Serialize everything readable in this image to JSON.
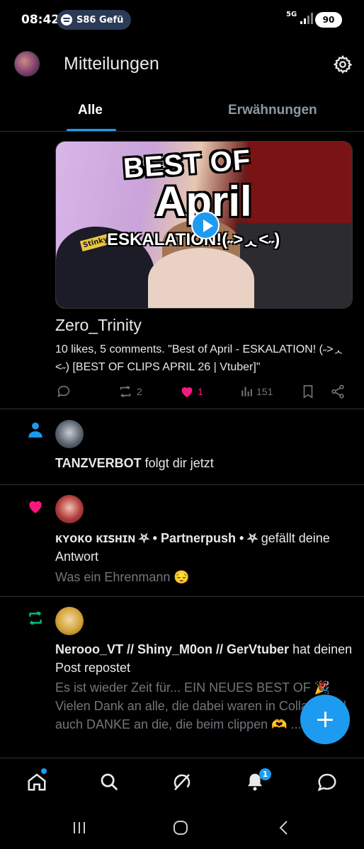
{
  "status_bar": {
    "time": "08:42",
    "media_label": "S86 Gefü",
    "network": "5G",
    "battery": "90"
  },
  "header": {
    "title": "Mitteilungen"
  },
  "tabs": [
    {
      "label": "Alle",
      "active": true
    },
    {
      "label": "Erwähnungen",
      "active": false
    }
  ],
  "media_card": {
    "headline_line1": "BEST OF",
    "headline_line2": "April",
    "headline_line3": "ESKALATION!(˶˃ᆺ˂˶)",
    "sticker": "Stinky",
    "author": "Zero_Trinity",
    "description": "10 likes, 5 comments. \"Best of April - ESKALATION! (˶˃ᆺ˂˶) [BEST OF CLIPS APRIL 26 | Vtuber]\"",
    "actions": {
      "replies": "",
      "reposts": "2",
      "likes": "1",
      "views": "151"
    }
  },
  "notifications": [
    {
      "type": "follow",
      "icon": "person-icon",
      "actor": "TANZVERBOT",
      "text": " folgt dir jetzt"
    },
    {
      "type": "like",
      "icon": "heart-icon",
      "actor": "ᴋʏᴏᴋᴏ ᴋɪꜱʜɪɴ ⛧ • Partnerpush • ⛧",
      "text": " gefällt deine Antwort",
      "preview": "Was ein Ehrenmann 😔"
    },
    {
      "type": "repost",
      "icon": "repost-icon",
      "actor": "Nerooo_VT // Shiny_M0on // GerVtuber",
      "text": " hat deinen Post repostet",
      "preview": "Es ist wieder Zeit für... EIN NEUES BEST OF 🎉 Vielen Dank an alle, die dabei waren in Collabs und auch DANKE an die, die beim clippen 🫶 ..."
    }
  ],
  "bottom_nav": {
    "items": [
      "home-icon",
      "search-icon",
      "grok-icon",
      "bell-icon",
      "messages-icon"
    ],
    "notification_count": "1"
  },
  "colors": {
    "accent": "#1d9bf0",
    "like": "#f91880",
    "repost": "#00ba7c"
  }
}
